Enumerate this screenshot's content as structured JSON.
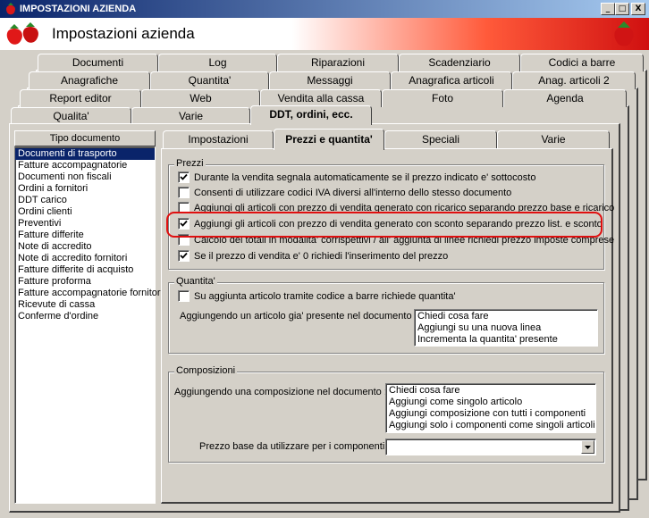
{
  "window": {
    "title": "IMPOSTAZIONI AZIENDA",
    "header_title": "Impostazioni azienda",
    "minimize": "_",
    "maximize": "□",
    "close": "X"
  },
  "main_tabs": {
    "row1": [
      "Documenti",
      "Log",
      "Riparazioni",
      "Scadenziario",
      "Codici a barre"
    ],
    "row2": [
      "Anagrafiche",
      "Quantita'",
      "Messaggi",
      "Anagrafica articoli",
      "Anag. articoli 2"
    ],
    "row3": [
      "Report editor",
      "Web",
      "Vendita alla cassa",
      "Foto",
      "Agenda"
    ],
    "row4": [
      "Qualita'",
      "Varie",
      "DDT, ordini, ecc."
    ]
  },
  "doc_type_list": {
    "header": "Tipo documento",
    "items": [
      "Documenti di trasporto",
      "Fatture accompagnatorie",
      "Documenti non fiscali",
      "Ordini a fornitori",
      "DDT carico",
      "Ordini clienti",
      "Preventivi",
      "Fatture differite",
      "Note di accredito",
      "Note di accredito fornitori",
      "Fatture differite di acquisto",
      "Fatture proforma",
      "Fatture accompagnatorie fornitori",
      "Ricevute di cassa",
      "Conferme d'ordine"
    ]
  },
  "sub_tabs": [
    "Impostazioni",
    "Prezzi e quantita'",
    "Speciali",
    "Varie"
  ],
  "prezzi": {
    "label": "Prezzi",
    "options": [
      "Durante la vendita segnala automaticamente se il prezzo indicato e' sottocosto",
      "Consenti di utilizzare codici IVA diversi all'interno dello stesso documento",
      "Aggiungi gli articoli con prezzo di vendita generato con ricarico separando prezzo base e ricarico",
      "Aggiungi gli articoli con prezzo di vendita generato con sconto separando prezzo list. e sconto",
      "Calcolo dei totali in modalita' corrispettivi / all' aggiunta di linee richiedi prezzo imposte comprese",
      "Se il prezzo di vendita e' 0 richiedi l'inserimento del prezzo"
    ],
    "checked": [
      true,
      false,
      false,
      true,
      false,
      true
    ]
  },
  "quantita": {
    "label": "Quantita'",
    "barcode_option": "Su aggiunta articolo tramite codice a barre richiede quantita'",
    "barcode_checked": false,
    "existing_label": "Aggiungendo un articolo gia' presente nel documento :",
    "existing_options": [
      "Chiedi cosa fare",
      "Aggiungi su una nuova linea",
      "Incrementa la quantita' presente"
    ]
  },
  "composizioni": {
    "label": "Composizioni",
    "add_label": "Aggiungendo una composizione nel documento :",
    "add_options": [
      "Chiedi cosa fare",
      "Aggiungi come singolo articolo",
      "Aggiungi composizione con tutti i componenti",
      "Aggiungi solo i componenti come singoli articoli"
    ],
    "price_label": "Prezzo base da utilizzare per i componenti :",
    "price_value": ""
  }
}
